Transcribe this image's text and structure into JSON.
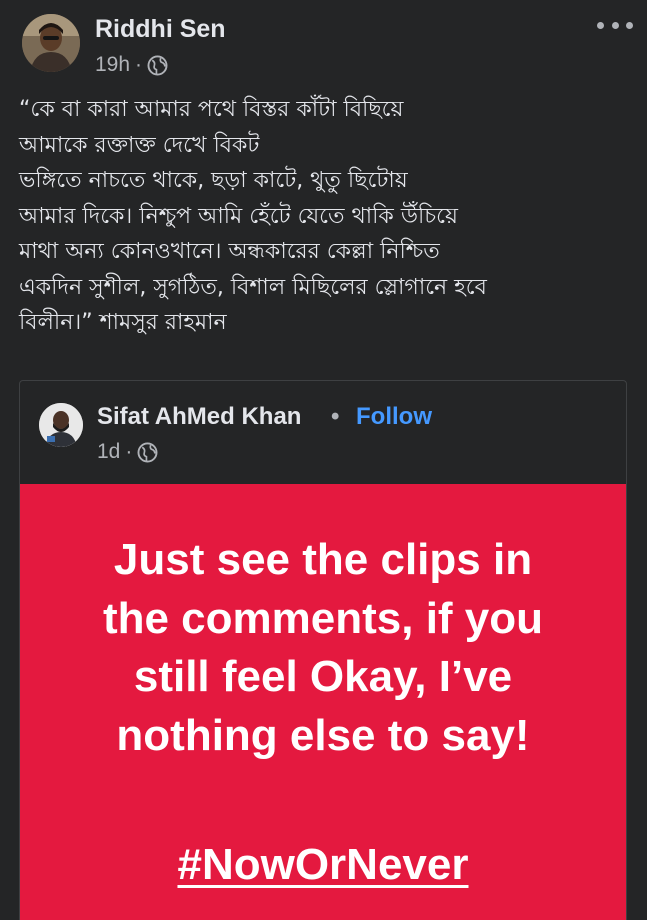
{
  "post": {
    "author": {
      "name": "Riddhi Sen",
      "avatar_icon": "profile-photo"
    },
    "time": "19h",
    "separator": "·",
    "privacy_icon": "globe-icon",
    "more_icon": "more-options-icon",
    "text_lines": [
      "“কে বা কারা আমার পথে বিস্তর কাঁটা বিছিয়ে",
      "আমাকে রক্তাক্ত দেখে বিকট",
      "ভঙ্গিতে নাচতে থাকে, ছড়া কাটে, থুতু ছিটোয়",
      "আমার দিকে। নিশ্চুপ আমি হেঁটে যেতে থাকি উঁচিয়ে",
      "মাথা অন্য কোনওখানে। অন্ধকারের কেল্লা নিশ্চিত",
      "একদিন সুশীল, সুগঠিত, বিশাল মিছিলের স্লোগানে হবে",
      "বিলীন।” শামসুর রাহমান"
    ]
  },
  "shared_post": {
    "author": {
      "name": "Sifat AhMed Khan",
      "avatar_icon": "profile-photo"
    },
    "name_separator": "•",
    "follow_label": "Follow",
    "time": "1d",
    "separator": "·",
    "privacy_icon": "globe-icon",
    "image": {
      "background": "#e4193f",
      "text_lines": [
        "Just see the clips in",
        "the comments, if you",
        "still feel Okay, I’ve",
        "nothing else to say!"
      ],
      "hashtag": "#NowOrNever"
    }
  },
  "colors": {
    "background": "#242526",
    "primary_text": "#e4e6eb",
    "secondary_text": "#b0b3b8",
    "link": "#4599ff",
    "border": "#3e4042"
  }
}
